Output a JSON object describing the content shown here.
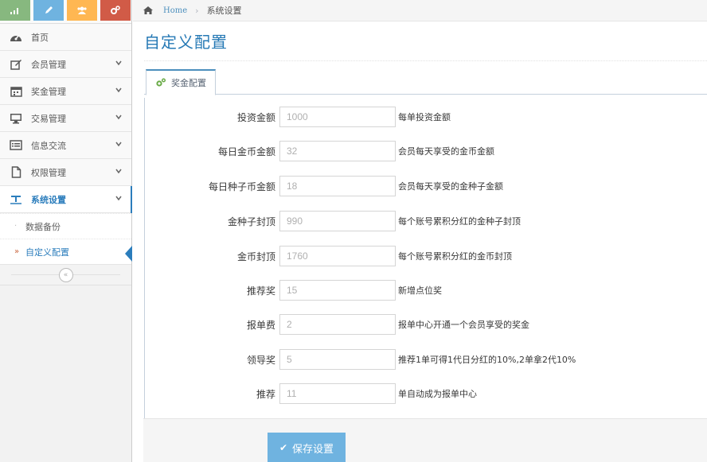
{
  "sidebar": {
    "shortcuts": [
      {
        "icon": "signal-icon",
        "color": "#87b87f"
      },
      {
        "icon": "pencil-icon",
        "color": "#6fb3e0"
      },
      {
        "icon": "group-icon",
        "color": "#ffb752"
      },
      {
        "icon": "cogs-icon",
        "color": "#d15b47"
      }
    ],
    "items": [
      {
        "label": "首页",
        "icon": "dashboard-icon"
      },
      {
        "label": "会员管理",
        "icon": "edit-icon"
      },
      {
        "label": "奖金管理",
        "icon": "calendar-icon"
      },
      {
        "label": "交易管理",
        "icon": "desktop-icon"
      },
      {
        "label": "信息交流",
        "icon": "list-alt-icon"
      },
      {
        "label": "权限管理",
        "icon": "file-icon"
      },
      {
        "label": "系统设置",
        "icon": "text-width-icon"
      }
    ],
    "subitems": [
      {
        "label": "数据备份"
      },
      {
        "label": "自定义配置"
      }
    ],
    "collapse_glyph": "«"
  },
  "breadcrumb": {
    "home": "Home",
    "separator": "›",
    "current": "系统设置"
  },
  "page": {
    "title": "自定义配置"
  },
  "tab": {
    "label": "奖金配置"
  },
  "form": {
    "rows": [
      {
        "label": "投资金额",
        "value": "1000",
        "help": "每单投资金额"
      },
      {
        "label": "每日金币金额",
        "value": "32",
        "help": "会员每天享受的金币金额"
      },
      {
        "label": "每日种子币金额",
        "value": "18",
        "help": "会员每天享受的金种子金额"
      },
      {
        "label": "金种子封顶",
        "value": "990",
        "help": "每个账号累积分红的金种子封顶"
      },
      {
        "label": "金币封顶",
        "value": "1760",
        "help": "每个账号累积分红的金币封顶"
      },
      {
        "label": "推荐奖",
        "value": "15",
        "help": "新增点位奖"
      },
      {
        "label": "报单费",
        "value": "2",
        "help": "报单中心开通一个会员享受的奖金"
      },
      {
        "label": "领导奖",
        "value": "5",
        "help": "推荐1单可得1代日分红的10%,2单拿2代10%"
      },
      {
        "label": "推荐",
        "value": "11",
        "help": "单自动成为报单中心"
      }
    ],
    "save_label": "保存设置"
  },
  "colors": {
    "accent": "#2b7dbc",
    "title": "#2679b5",
    "save_button": "#6fb3e0"
  }
}
